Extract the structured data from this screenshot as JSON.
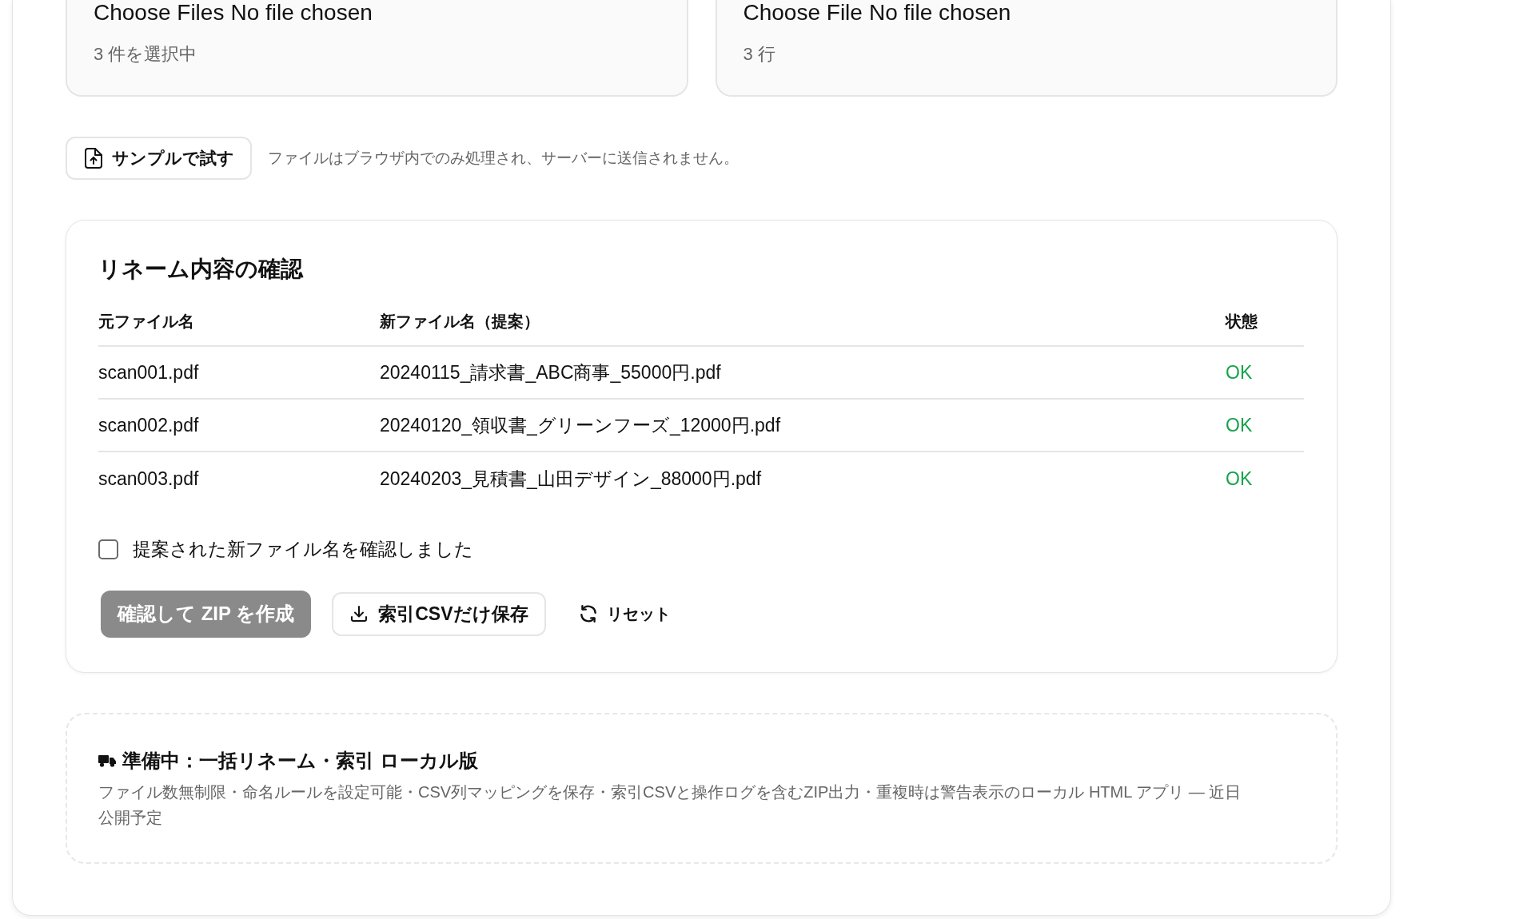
{
  "upload_cards": [
    {
      "button_label": "Choose Files",
      "file_name": "No file chosen",
      "status": "3 件を選択中"
    },
    {
      "button_label": "Choose File",
      "file_name": "No file chosen",
      "status": "3 行"
    }
  ],
  "sample_button": {
    "label": "サンプルで試す"
  },
  "privacy_note": "ファイルはブラウザ内でのみ処理され、サーバーに送信されません。",
  "review": {
    "title": "リネーム内容の確認",
    "table": {
      "columns": [
        "元ファイル名",
        "新ファイル名（提案）",
        "状態"
      ],
      "rows": [
        {
          "original": "scan001.pdf",
          "proposed": "20240115_請求書_ABC商事_55000円.pdf",
          "status": "OK"
        },
        {
          "original": "scan002.pdf",
          "proposed": "20240120_領収書_グリーンフーズ_12000円.pdf",
          "status": "OK"
        },
        {
          "original": "scan003.pdf",
          "proposed": "20240203_見積書_山田デザイン_88000円.pdf",
          "status": "OK"
        }
      ]
    },
    "confirm": {
      "label": "提案された新ファイル名を確認しました",
      "checked": false
    },
    "buttons": [
      {
        "kind": "primary",
        "label": "確認して ZIP を作成",
        "disabled": true
      },
      {
        "kind": "secondary",
        "label": "索引CSVだけ保存",
        "disabled": false
      },
      {
        "kind": "ghost",
        "label": "リセット",
        "disabled": false
      }
    ]
  },
  "coming_soon": {
    "title": "準備中：一括リネーム・索引 ローカル版",
    "description": "ファイル数無制限・命名ルールを設定可能・CSV列マッピングを保存・索引CSVと操作ログを含むZIP出力・重複時は警告表示のローカル HTML アプリ — 近日公開予定"
  }
}
